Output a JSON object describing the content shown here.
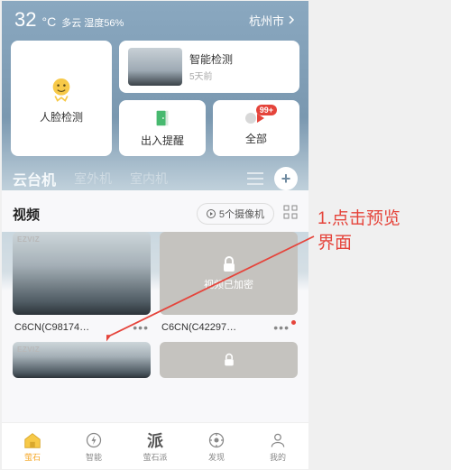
{
  "status": {
    "temperature": "32",
    "unit": "°C",
    "weather": "多云 湿度56%",
    "city": "杭州市"
  },
  "cards": {
    "face": "人脸检测",
    "smart": {
      "title": "智能检测",
      "sub": "5天前"
    },
    "door": "出入提醒",
    "all": {
      "label": "全部",
      "badge": "99+"
    }
  },
  "tabs": {
    "t1": "云台机",
    "t2": "室外机",
    "t3": "室内机"
  },
  "section": {
    "title": "视频",
    "cam_count": "5个摄像机"
  },
  "videos": {
    "v1": "C6CN(C98174…",
    "v2": "C6CN(C42297…",
    "locked": "视频已加密",
    "brand": "EZVIZ"
  },
  "nav": {
    "n1": "萤石",
    "n2": "智能",
    "n3": "萤石派",
    "n4": "发现",
    "n5": "我的",
    "pai": "派"
  },
  "annotation": {
    "line1": "1.点击预览",
    "line2": "界面"
  }
}
